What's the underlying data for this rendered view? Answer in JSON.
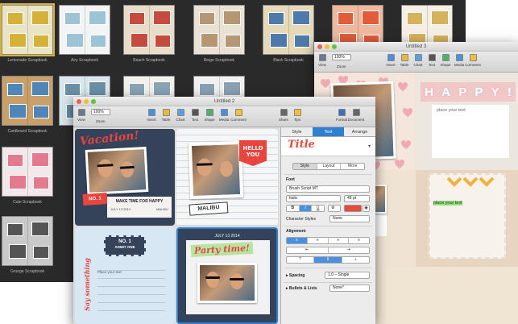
{
  "chooser": {
    "templates": [
      {
        "label": "Lemonade Scrapbook",
        "color": "#e9e4c5",
        "accent": "#d6b13a",
        "selected": true
      },
      {
        "label": "Airy Scrapbook",
        "color": "#f2f4f6",
        "accent": "#9cc4d6"
      },
      {
        "label": "Beach Scrapbook",
        "color": "#e8ddc9",
        "accent": "#c44b3d"
      },
      {
        "label": "Beige Scrapbook",
        "color": "#e9e2d4",
        "accent": "#b69673"
      },
      {
        "label": "Black Scrapbook",
        "color": "#e6d9b8",
        "accent": "#4d7aa8"
      },
      {
        "label": "",
        "color": "#f0b99e",
        "accent": "#e25c3a"
      },
      {
        "label": "",
        "color": "#f5efe6",
        "accent": "#d7b25c"
      },
      {
        "label": "Cardboard Scrapbook",
        "color": "#caa06a",
        "accent": "#4f86b8"
      },
      {
        "label": "",
        "color": "#d9e6ec",
        "accent": "#6a8fa6"
      },
      {
        "label": "",
        "color": "#f3f0ea",
        "accent": "#88a4b5"
      },
      {
        "label": "",
        "color": "#f0f0f0",
        "accent": "#8aa0b4"
      },
      {
        "label": "Cute Scrapbook",
        "color": "#f2e8ea",
        "accent": "#e37a8e"
      },
      {
        "label": "Grunge Scrapbook",
        "color": "#c9c9c9",
        "accent": "#555555"
      }
    ]
  },
  "win3": {
    "title": "Untitled 3",
    "zoom": "100%",
    "toolbar": [
      {
        "name": "view",
        "label": "View",
        "color": "#6a7a8c"
      },
      {
        "name": "zoom",
        "label": "Zoom",
        "color": "#ffffff"
      },
      {
        "name": "insert",
        "label": "Insert",
        "color": "#4a90e2"
      },
      {
        "name": "table",
        "label": "Table",
        "color": "#e8b93c"
      },
      {
        "name": "chart",
        "label": "Chart",
        "color": "#5aa0e0"
      },
      {
        "name": "text",
        "label": "Text",
        "color": "#555555"
      },
      {
        "name": "shape",
        "label": "Shape",
        "color": "#4cb36a"
      },
      {
        "name": "media",
        "label": "Media",
        "color": "#4a90e2"
      },
      {
        "name": "comment",
        "label": "Comment",
        "color": "#f0c03c"
      }
    ],
    "happy": [
      "H",
      "A",
      "P",
      "P",
      "Y",
      "!"
    ],
    "caption": "place your text",
    "highlight": "place your text"
  },
  "win2": {
    "title": "Untitled 2",
    "zoom": "100%",
    "toolbar_left": [
      {
        "name": "view",
        "label": "View",
        "color": "#6a7a8c"
      },
      {
        "name": "zoom",
        "label": "Zoom",
        "color": "#ffffff"
      }
    ],
    "toolbar_mid": [
      {
        "name": "insert",
        "label": "Insert",
        "color": "#4a90e2"
      },
      {
        "name": "table",
        "label": "Table",
        "color": "#e8b93c"
      },
      {
        "name": "chart",
        "label": "Chart",
        "color": "#5aa0e0"
      },
      {
        "name": "text",
        "label": "Text",
        "color": "#555555"
      },
      {
        "name": "shape",
        "label": "Shape",
        "color": "#4cb36a"
      },
      {
        "name": "media",
        "label": "Media",
        "color": "#4a90e2"
      },
      {
        "name": "comment",
        "label": "Comment",
        "color": "#f0c03c"
      }
    ],
    "toolbar_right": [
      {
        "name": "share",
        "label": "Share",
        "color": "#666666"
      },
      {
        "name": "tips",
        "label": "Tips",
        "color": "#f0c03c"
      },
      {
        "name": "format",
        "label": "Format",
        "color": "#3b6fb6"
      },
      {
        "name": "document",
        "label": "Document",
        "color": "#666666"
      }
    ],
    "page": {
      "vacation": "Vacation!",
      "no": "NO. 1",
      "make_time": "MAKE TIME FOR HAPPY",
      "date_left": "JULY 13 2014",
      "place_left": "MALIBU",
      "hello": "HELLO",
      "you": "YOU",
      "malibu_tag": "MALIBU",
      "ticket_no": "NO. 1",
      "ticket_admit": "ADMIT ONE",
      "say_something": "Say something",
      "place_your_text": "Place your text",
      "date_right": "JULY 13 2014",
      "party": "Party time!"
    }
  },
  "inspector": {
    "tabs": [
      "Style",
      "Text",
      "Arrange"
    ],
    "active_tab": "Text",
    "style_preview": "Title",
    "subtabs": [
      "Style",
      "Layout",
      "More"
    ],
    "font_label": "Font",
    "font_family": "Brush Script MT",
    "font_style": "Italic",
    "font_size": "48 pt",
    "text_buttons": [
      "B",
      "I",
      "U"
    ],
    "char_styles_label": "Character Styles",
    "char_styles_value": "None",
    "alignment_label": "Alignment",
    "spacing_label": "Spacing",
    "spacing_value": "1.0 – Single",
    "bullets_label": "Bullets & Lists",
    "bullets_value": "None*",
    "text_color": "#e84a3c",
    "accent": "#2f80d0"
  }
}
